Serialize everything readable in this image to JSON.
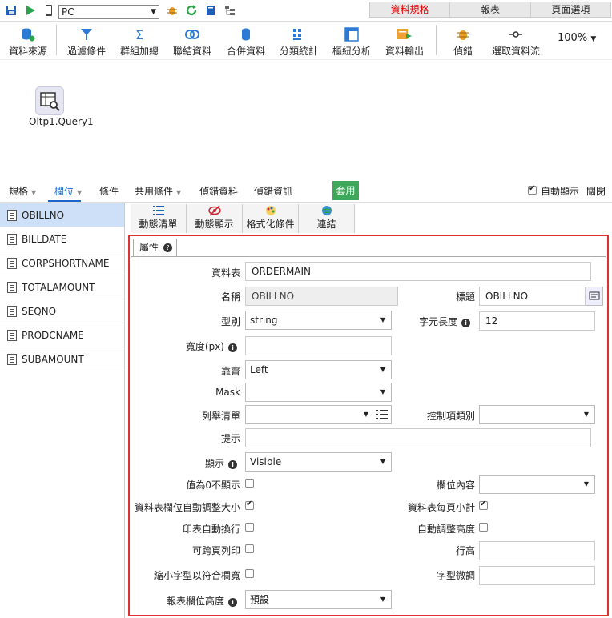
{
  "topbar": {
    "combo_value": "PC",
    "tabs": [
      "資料規格",
      "報表",
      "頁面選項"
    ]
  },
  "toolbar": {
    "items": [
      "資料來源",
      "過濾條件",
      "群組加總",
      "聯結資料",
      "合併資料",
      "分類統計",
      "樞紐分析",
      "資料輸出",
      "偵錯",
      "選取資料流"
    ],
    "zoom": "100%"
  },
  "canvas": {
    "node_label": "Oltp1.Query1"
  },
  "menubar": {
    "items": [
      "規格",
      "欄位",
      "條件",
      "共用條件",
      "偵錯資料",
      "偵錯資訊"
    ],
    "apply": "套用",
    "auto_show": "自動顯示",
    "close": "關閉"
  },
  "fields": [
    "OBILLNO",
    "BILLDATE",
    "CORPSHORTNAME",
    "TOTALAMOUNT",
    "SEQNO",
    "PRODCNAME",
    "SUBAMOUNT"
  ],
  "subtoolbar": [
    "動態清單",
    "動態顯示",
    "格式化條件",
    "連結"
  ],
  "props": {
    "tab": "屬性",
    "table_label": "資料表",
    "table_value": "ORDERMAIN",
    "name_label": "名稱",
    "name_value": "OBILLNO",
    "title_label": "標題",
    "title_value": "OBILLNO",
    "type_label": "型別",
    "type_value": "string",
    "charlen_label": "字元長度",
    "charlen_value": "12",
    "width_label": "寬度(px)",
    "align_label": "靠齊",
    "align_value": "Left",
    "mask_label": "Mask",
    "enum_label": "列舉清單",
    "ctrltype_label": "控制項類別",
    "hint_label": "提示",
    "display_label": "顯示",
    "display_value": "Visible",
    "zero_label": "值為0不顯示",
    "fieldcontent_label": "欄位內容",
    "autosize_label": "資料表欄位自動調整大小",
    "subtotal_label": "資料表每頁小計",
    "wrap_label": "印表自動換行",
    "autoheight_label": "自動調整高度",
    "crosspage_label": "可跨頁列印",
    "rowheight_label": "行高",
    "shrink_label": "縮小字型以符合欄寬",
    "fontadj_label": "字型微調",
    "reportheight_label": "報表欄位高度",
    "reportheight_value": "預設"
  }
}
